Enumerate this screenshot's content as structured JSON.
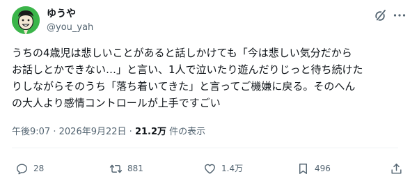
{
  "author": {
    "display_name": "ゆうや",
    "handle": "@you_yah",
    "avatar_icon": "cartoon-face-avatar",
    "avatar_bg": "#3bb54a"
  },
  "header_icons": [
    "grok-icon",
    "more-icon"
  ],
  "post": {
    "lines": [
      "うちの4歳児は悲しいことがあると話しかけても「今は悲しい気分だから",
      "お話しとかできない…」と言い、1人で泣いたり遊んだりじっと待ち続けた",
      "りしながらそのうち「落ち着いてきた」と言ってご機嫌に戻る。そのへん",
      "の大人より感情コントロールが上手ですごい"
    ]
  },
  "meta": {
    "time": "午後9:07",
    "separator": "·",
    "date": "2026年9月22日",
    "views_count": "21.2万",
    "views_label": "件の表示"
  },
  "actions": {
    "reply": {
      "icon": "reply-icon",
      "count": "28"
    },
    "repost": {
      "icon": "repost-icon",
      "count": "881"
    },
    "like": {
      "icon": "heart-icon",
      "count": "1.4万"
    },
    "bookmark": {
      "icon": "bookmark-icon",
      "count": "496"
    },
    "share": {
      "icon": "share-icon"
    }
  },
  "colors": {
    "text_primary": "#0f1419",
    "text_secondary": "#536471",
    "divider": "#eff3f4"
  }
}
